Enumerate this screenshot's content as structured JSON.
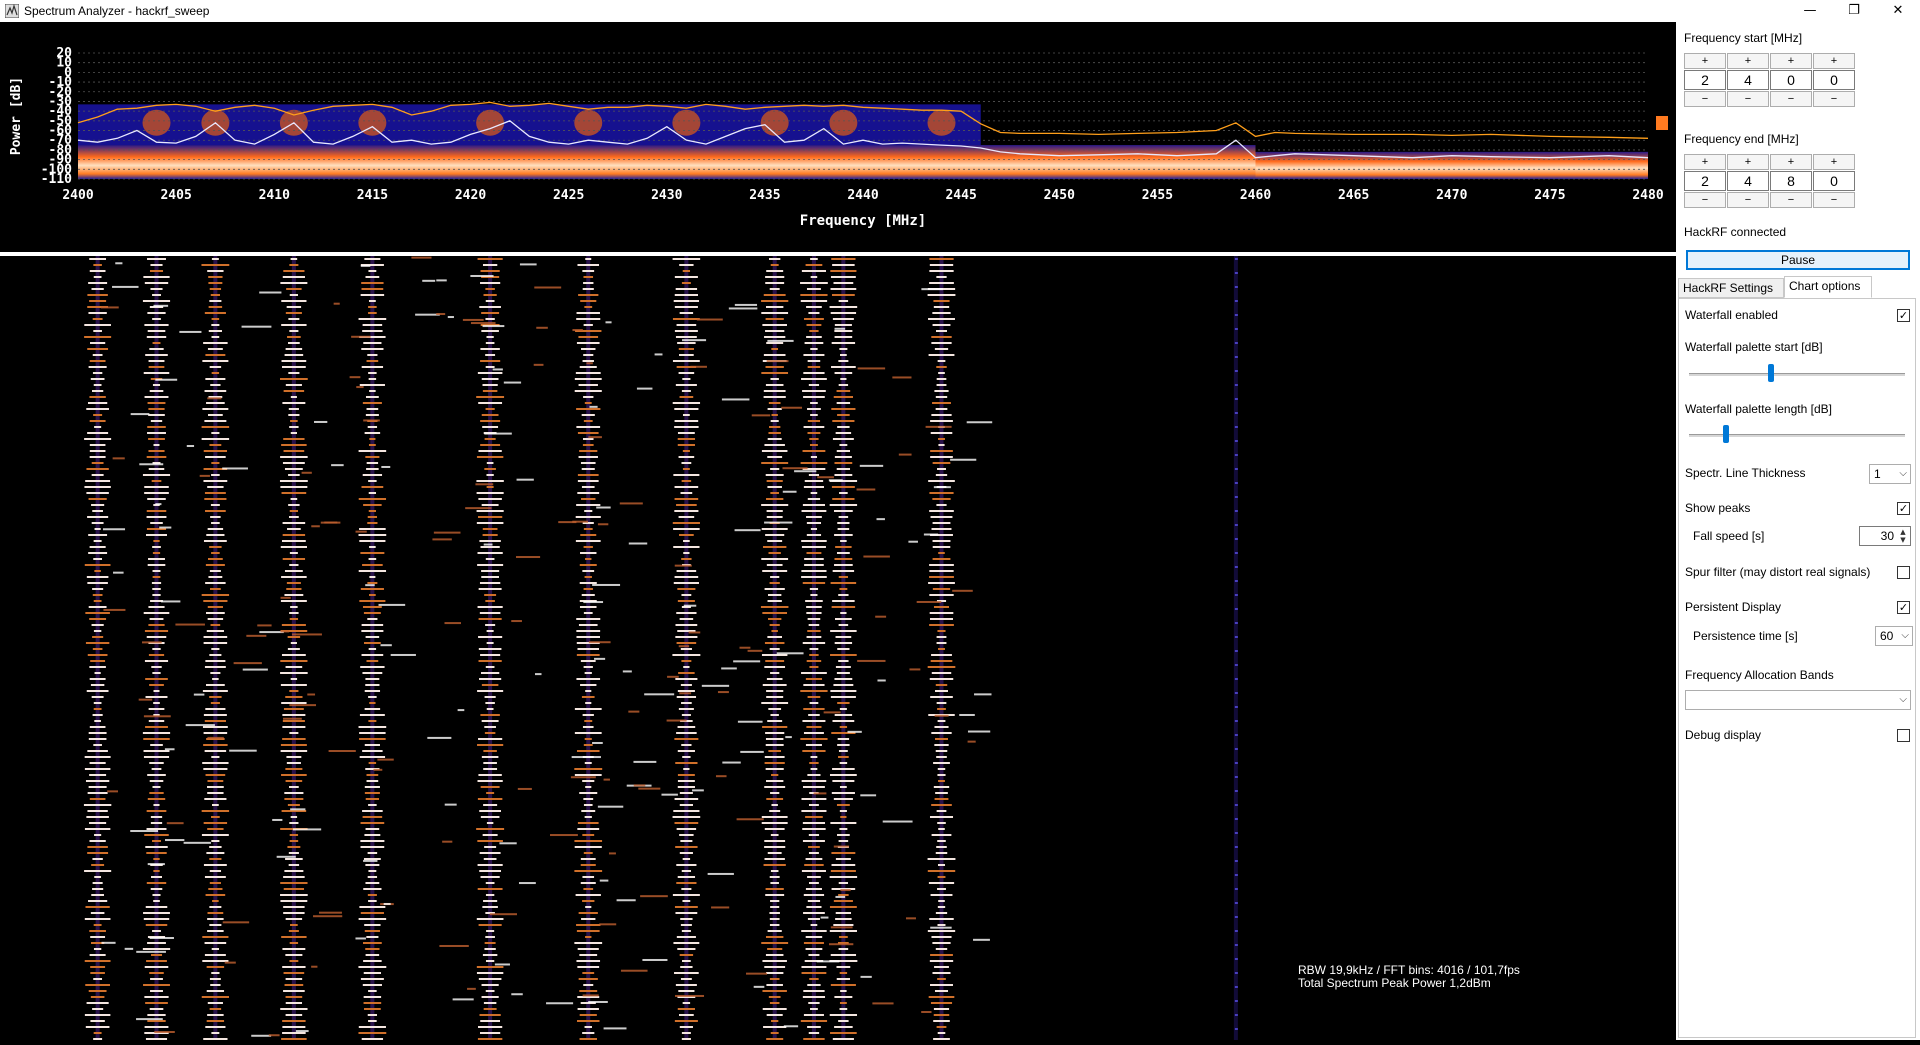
{
  "window": {
    "title": "Spectrum Analyzer - hackrf_sweep",
    "minimize_glyph": "—",
    "restore_glyph": "❐",
    "close_glyph": "✕"
  },
  "chart_data": {
    "type": "line",
    "xlabel": "Frequency [MHz]",
    "ylabel": "Power [dB]",
    "xlim": [
      2400,
      2480
    ],
    "ylim": [
      -110,
      20
    ],
    "x_ticks": [
      2400,
      2405,
      2410,
      2415,
      2420,
      2425,
      2430,
      2435,
      2440,
      2445,
      2450,
      2455,
      2460,
      2465,
      2470,
      2475,
      2480
    ],
    "y_ticks": [
      20,
      10,
      0,
      -10,
      -20,
      -30,
      -40,
      -50,
      -60,
      -70,
      -80,
      -90,
      -100,
      -110
    ],
    "grid": true,
    "series": [
      {
        "color": "#ff9f1a",
        "x": [
          2400,
          2401,
          2402,
          2403,
          2404,
          2405,
          2406,
          2407,
          2408,
          2409,
          2410,
          2411,
          2412,
          2413,
          2414,
          2415,
          2416,
          2417,
          2418,
          2419,
          2420,
          2421,
          2422,
          2423,
          2424,
          2425,
          2426,
          2427,
          2428,
          2429,
          2430,
          2431,
          2432,
          2433,
          2434,
          2435,
          2436,
          2437,
          2438,
          2439,
          2440,
          2441,
          2442,
          2443,
          2444,
          2445,
          2446,
          2447,
          2448,
          2450,
          2452,
          2454,
          2456,
          2458,
          2459,
          2460,
          2461,
          2462,
          2465,
          2468,
          2470,
          2472,
          2475,
          2478,
          2480
        ],
        "y": [
          -52,
          -46,
          -38,
          -37,
          -34,
          -33,
          -35,
          -40,
          -36,
          -34,
          -37,
          -44,
          -39,
          -35,
          -34,
          -33,
          -36,
          -44,
          -40,
          -34,
          -33,
          -31,
          -35,
          -34,
          -32,
          -35,
          -38,
          -36,
          -36,
          -34,
          -35,
          -37,
          -33,
          -35,
          -38,
          -36,
          -35,
          -34,
          -35,
          -34,
          -36,
          -37,
          -38,
          -39,
          -39,
          -40,
          -53,
          -62,
          -63,
          -63,
          -64,
          -63,
          -62,
          -60,
          -52,
          -66,
          -62,
          -63,
          -64,
          -64,
          -65,
          -64,
          -66,
          -67,
          -68
        ]
      },
      {
        "color": "#e8e8ff",
        "x": [
          2400,
          2401,
          2402,
          2403,
          2404,
          2405,
          2406,
          2407,
          2408,
          2409,
          2410,
          2411,
          2412,
          2413,
          2414,
          2415,
          2416,
          2417,
          2418,
          2419,
          2420,
          2421,
          2422,
          2423,
          2424,
          2425,
          2426,
          2427,
          2428,
          2429,
          2430,
          2431,
          2432,
          2433,
          2434,
          2435,
          2436,
          2437,
          2438,
          2439,
          2440,
          2441,
          2442,
          2443,
          2444,
          2445,
          2446,
          2447,
          2448,
          2450,
          2452,
          2454,
          2456,
          2458,
          2459,
          2460,
          2461,
          2462,
          2465,
          2468,
          2470,
          2472,
          2475,
          2478,
          2480
        ],
        "y": [
          -70,
          -72,
          -68,
          -60,
          -72,
          -73,
          -66,
          -52,
          -70,
          -74,
          -64,
          -52,
          -72,
          -74,
          -66,
          -56,
          -72,
          -70,
          -74,
          -72,
          -64,
          -58,
          -50,
          -66,
          -72,
          -74,
          -70,
          -72,
          -74,
          -68,
          -56,
          -70,
          -74,
          -66,
          -58,
          -54,
          -72,
          -70,
          -58,
          -74,
          -70,
          -74,
          -73,
          -74,
          -75,
          -76,
          -78,
          -82,
          -84,
          -86,
          -85,
          -84,
          -86,
          -84,
          -70,
          -88,
          -86,
          -84,
          -86,
          -88,
          -86,
          -87,
          -88,
          -86,
          -88
        ]
      }
    ]
  },
  "waterfall": {
    "columns_mhz": [
      2401,
      2404,
      2407,
      2411,
      2415,
      2421,
      2426,
      2431,
      2435.5,
      2437.5,
      2439,
      2444,
      2459
    ]
  },
  "info": {
    "line1": "RBW 19,9kHz / FFT bins: 4016 / 101,7fps",
    "line2": "Total Spectrum Peak Power 1,2dBm"
  },
  "panel": {
    "freq_start_label": "Frequency start [MHz]",
    "freq_start_digits": [
      "2",
      "4",
      "0",
      "0"
    ],
    "freq_end_label": "Frequency end [MHz]",
    "freq_end_digits": [
      "2",
      "4",
      "8",
      "0"
    ],
    "plus": "+",
    "minus": "−",
    "status": "HackRF connected",
    "pause_label": "Pause",
    "tabs": [
      "HackRF Settings",
      "Chart options"
    ],
    "active_tab": "Chart options",
    "waterfall_enabled_label": "Waterfall enabled",
    "waterfall_enabled": true,
    "palette_start_label": "Waterfall palette start [dB]",
    "palette_start_level": 0.38,
    "palette_length_label": "Waterfall palette length [dB]",
    "palette_length_level": 0.17,
    "line_thickness_label": "Spectr. Line Thickness",
    "line_thickness_value": "1",
    "show_peaks_label": "Show peaks",
    "show_peaks": true,
    "fall_speed_label": "Fall speed [s]",
    "fall_speed_value": "30",
    "spur_filter_label": "Spur filter (may distort real signals)",
    "spur_filter": false,
    "persistent_label": "Persistent Display",
    "persistent": true,
    "persistence_time_label": "Persistence time [s]",
    "persistence_time_value": "60",
    "allocation_bands_label": "Frequency Allocation Bands",
    "allocation_bands_value": "",
    "debug_label": "Debug display",
    "debug": false,
    "check_glyph": "✓",
    "arrow_glyph": "⌵",
    "up_glyph": "▲",
    "down_glyph": "▼"
  }
}
